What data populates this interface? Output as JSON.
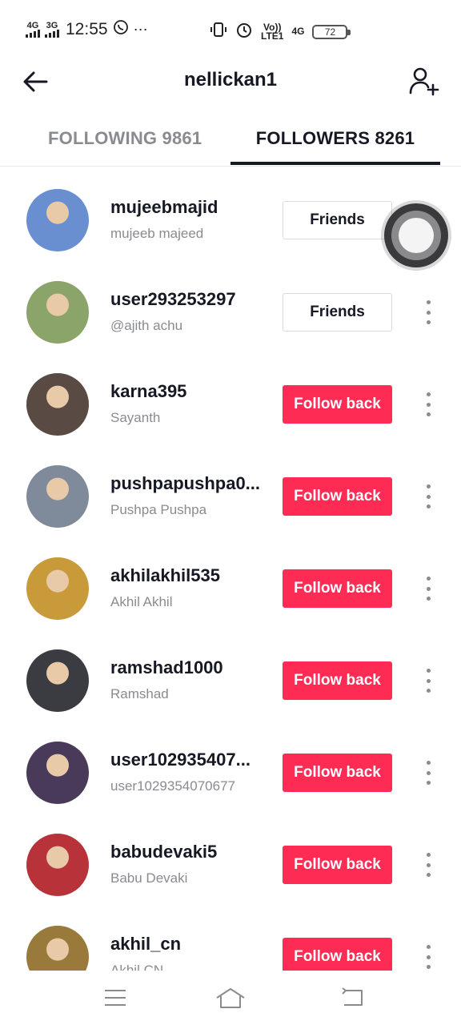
{
  "status_bar": {
    "network1": "4G",
    "network2": "3G",
    "time": "12:55",
    "volte": "Vo))",
    "lte": "LTE1",
    "network3": "4G",
    "battery": "72",
    "icons": [
      "signal-icon",
      "whatsapp-icon",
      "more-dots-icon",
      "vibrate-icon",
      "alarm-icon"
    ]
  },
  "header": {
    "title": "nellickan1",
    "back_icon": "back-arrow-icon",
    "add_icon": "add-user-icon"
  },
  "tabs": [
    {
      "label": "FOLLOWING 9861",
      "active": false
    },
    {
      "label": "FOLLOWERS 8261",
      "active": true
    }
  ],
  "followers": [
    {
      "username": "mujeebmajid",
      "nickname": "mujeeb majeed",
      "button": "Friends",
      "type": "friends",
      "avatar_color": "#6a8fd0"
    },
    {
      "username": "user293253297",
      "nickname": "@ajith achu",
      "button": "Friends",
      "type": "friends",
      "avatar_color": "#8aa46a"
    },
    {
      "username": "karna395",
      "nickname": "Sayanth",
      "button": "Follow back",
      "type": "follow",
      "avatar_color": "#5a4a44"
    },
    {
      "username": "pushpapushpa0...",
      "nickname": "Pushpa Pushpa",
      "button": "Follow back",
      "type": "follow",
      "avatar_color": "#7f8a9a"
    },
    {
      "username": "akhilakhil535",
      "nickname": "Akhil Akhil",
      "button": "Follow back",
      "type": "follow",
      "avatar_color": "#c89a3a"
    },
    {
      "username": "ramshad1000",
      "nickname": "Ramshad",
      "button": "Follow back",
      "type": "follow",
      "avatar_color": "#3b3b42"
    },
    {
      "username": "user102935407...",
      "nickname": "user1029354070677",
      "button": "Follow back",
      "type": "follow",
      "avatar_color": "#4a3a5a"
    },
    {
      "username": "babudevaki5",
      "nickname": "Babu Devaki",
      "button": "Follow back",
      "type": "follow",
      "avatar_color": "#b8323a"
    },
    {
      "username": "akhil_cn",
      "nickname": "Akhil CN",
      "button": "Follow back",
      "type": "follow",
      "avatar_color": "#9a7a3a"
    }
  ],
  "navbar": {
    "icons": [
      "menu-icon",
      "home-icon",
      "back-icon"
    ]
  },
  "colors": {
    "accent": "#fe2c55",
    "text_primary": "#161823",
    "text_secondary": "#8a8b91"
  }
}
